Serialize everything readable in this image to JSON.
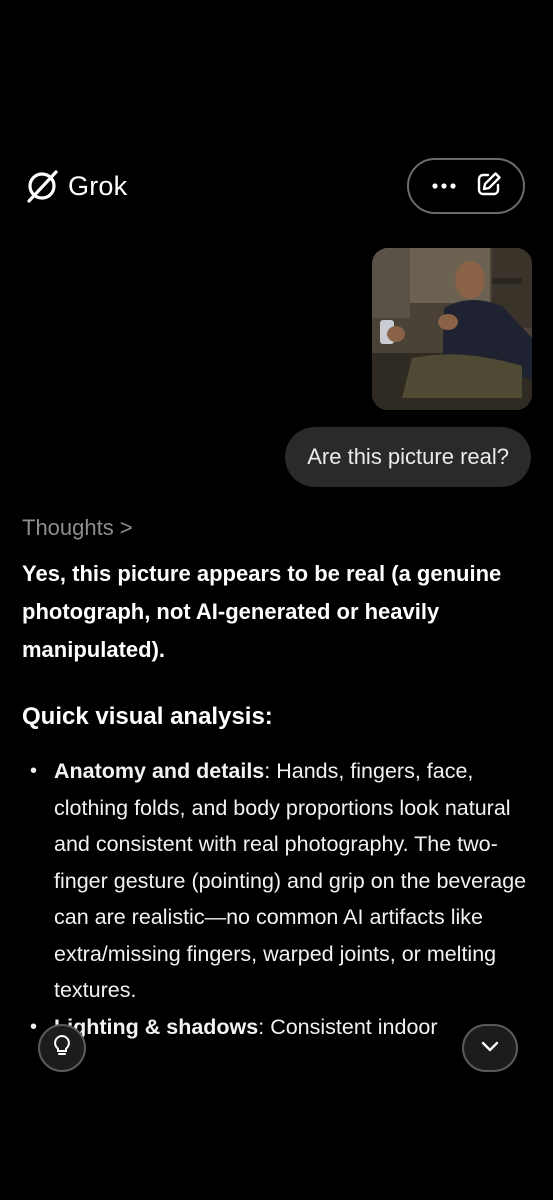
{
  "header": {
    "brand_name": "Grok",
    "logo_icon": "grok-slash-circle-icon",
    "more_icon": "more-horizontal-icon",
    "new_chat_icon": "edit-icon"
  },
  "conversation": {
    "user_message": "Are this picture real?",
    "thoughts_label": "Thoughts",
    "thoughts_chevron": ">",
    "answer_lead": "Yes, this picture appears to be real (a genuine photograph, not AI-generated or heavily manipulated).",
    "section_heading": "Quick visual analysis:",
    "points": [
      {
        "term": "Anatomy and details",
        "text": ": Hands, fingers, face, clothing folds, and body proportions look natural and consistent with real photography. The two-finger gesture (pointing) and grip on the beverage can are realistic—no common AI artifacts like extra/missing fingers, warped joints, or melting textures."
      },
      {
        "term": "Lighting & shadows",
        "text": ": Consistent indoor"
      }
    ]
  },
  "floating": {
    "left_icon": "lightbulb-icon",
    "right_icon": "chevron-down-icon"
  },
  "colors": {
    "background": "#000000",
    "bubble": "#2a2a2a",
    "muted_text": "#8e8e8e"
  }
}
